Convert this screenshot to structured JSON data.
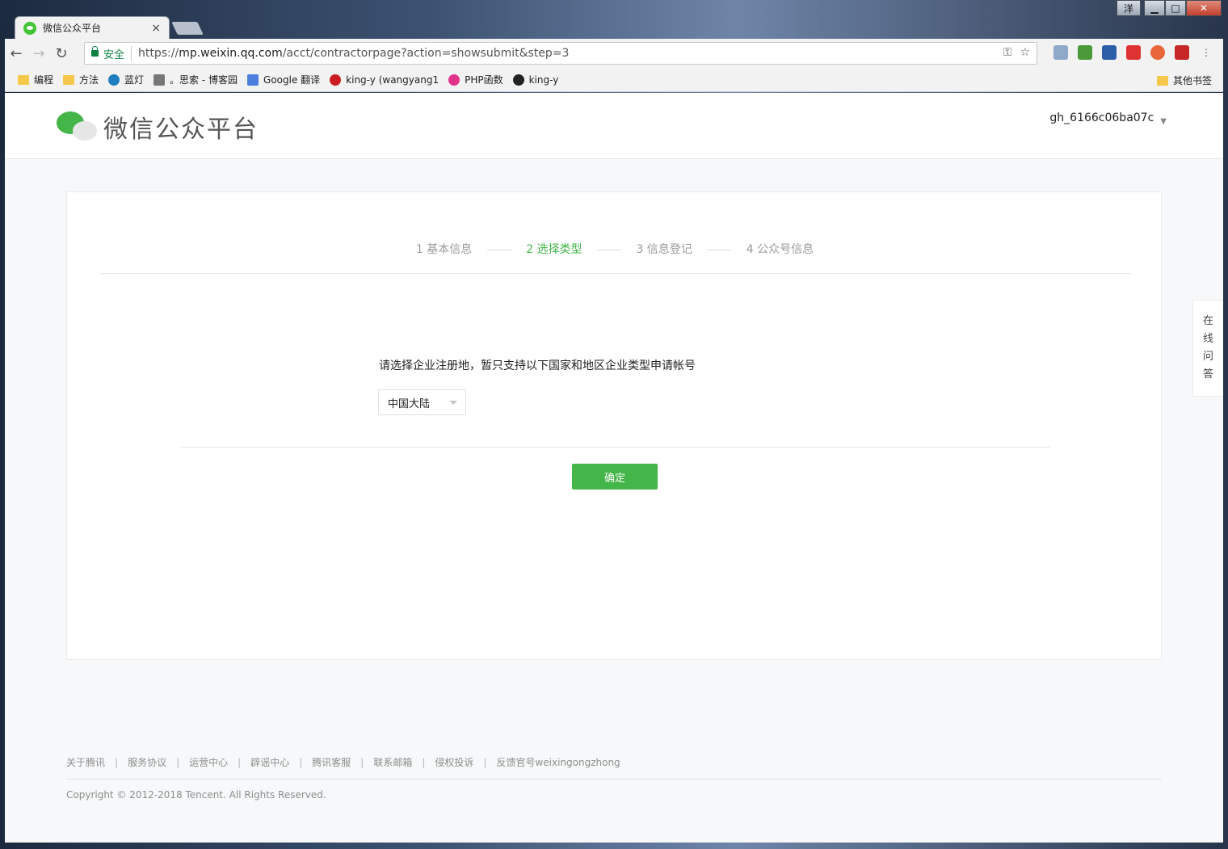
{
  "browser": {
    "tab_title": "微信公众平台",
    "tab_close": "×",
    "user_badge": "洋",
    "window_min": "▁",
    "window_max": "□",
    "window_close": "✕",
    "secure_label": "安全",
    "url_scheme": "https://",
    "url_host": "mp.weixin.qq.com",
    "url_path": "/acct/contractorpage?action=showsubmit&step=3"
  },
  "bookmarks": {
    "items": [
      "编程",
      "方法",
      "蓝灯",
      "。思索 - 博客园",
      "Google 翻译",
      "king-y (wangyang1",
      "PHP函数",
      "king-y"
    ],
    "other": "其他书签"
  },
  "header": {
    "logo_text": "微信公众平台",
    "account": "gh_6166c06ba07c"
  },
  "steps": [
    "1 基本信息",
    "2 选择类型",
    "3 信息登记",
    "4 公众号信息"
  ],
  "form": {
    "prompt": "请选择企业注册地，暂只支持以下国家和地区企业类型申请帐号",
    "region_selected": "中国大陆",
    "confirm_label": "确定"
  },
  "side_tab": [
    "在",
    "线",
    "问",
    "答"
  ],
  "footer": {
    "links": [
      "关于腾讯",
      "服务协议",
      "运营中心",
      "辟谣中心",
      "腾讯客服",
      "联系邮箱",
      "侵权投诉",
      "反馈官号weixingongzhong"
    ],
    "separator": "|",
    "copyright": "Copyright © 2012-2018 Tencent. All Rights Reserved."
  },
  "colors": {
    "accent": "#44b549",
    "page_bg": "#f6f8f9"
  }
}
